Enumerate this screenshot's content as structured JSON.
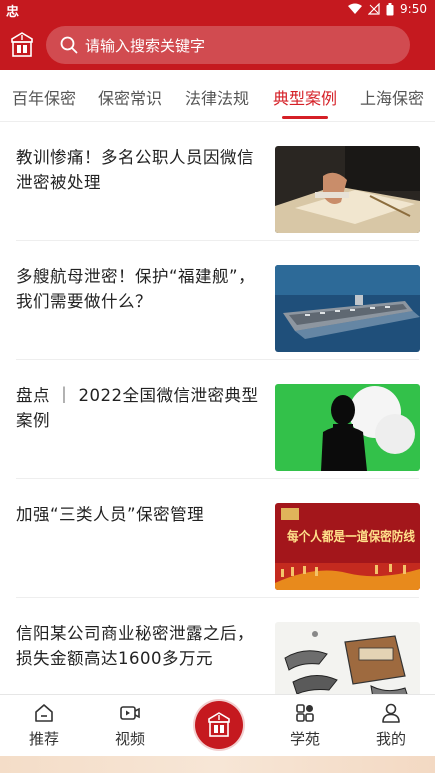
{
  "status_bar": {
    "app_glyph": "忠",
    "time": "9:50"
  },
  "search": {
    "placeholder": "请输入搜索关键字"
  },
  "tabs": [
    {
      "label": "百年保密"
    },
    {
      "label": "保密常识"
    },
    {
      "label": "法律法规"
    },
    {
      "label": "典型案例",
      "active": true
    },
    {
      "label": "上海保密"
    }
  ],
  "news": [
    {
      "title": "教训惨痛！多名公职人员因微信泄密被处理"
    },
    {
      "title": "多艘航母泄密！保护“福建舰”，我们需要做什么？"
    },
    {
      "title": "盘点 ｜ 2022全国微信泄密典型案例"
    },
    {
      "title": "加强“三类人员”保密管理",
      "thumb_text": "每个人都是一道保密防线"
    },
    {
      "title": "信阳某公司商业秘密泄露之后，损失金额高达1600多万元"
    }
  ],
  "bottom_nav": [
    {
      "label": "推荐",
      "icon": "home-icon"
    },
    {
      "label": "视频",
      "icon": "video-icon"
    },
    {
      "label": "学苑",
      "icon": "apps-icon"
    },
    {
      "label": "我的",
      "icon": "profile-icon"
    }
  ],
  "colors": {
    "brand_red": "#c5191f",
    "active_tab": "#d51f26"
  }
}
